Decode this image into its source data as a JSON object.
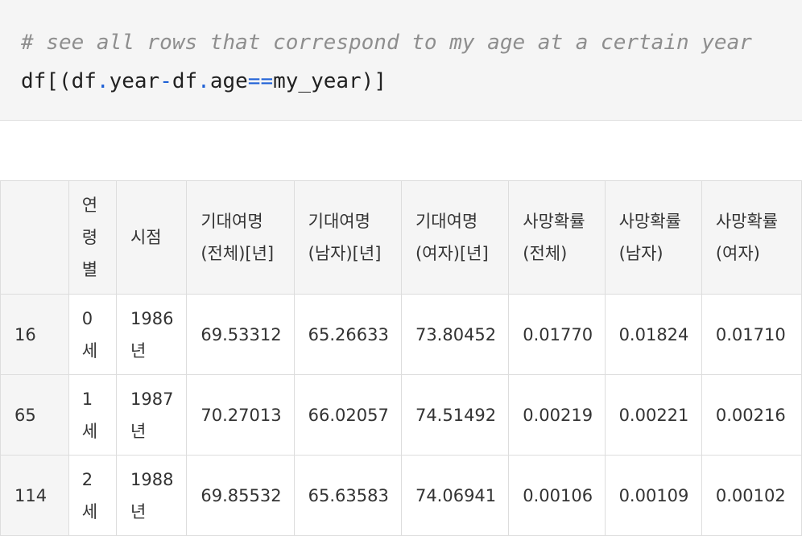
{
  "code_cell": {
    "comment": "# see all rows that correspond to my age at a certain year",
    "code_tokens": [
      "df[(df",
      ".",
      "year",
      "-",
      "df",
      ".",
      "age",
      "==",
      "my_year)]"
    ]
  },
  "table": {
    "columns": [
      "",
      "연령별",
      "시점",
      "기대여명(전체)[년]",
      "기대여명(남자)[년]",
      "기대여명(여자)[년]",
      "사망확률(전체)",
      "사망확률(남자)",
      "사망확률(여자)"
    ],
    "rows": [
      [
        "16",
        "0세",
        "1986년",
        "69.53312",
        "65.26633",
        "73.80452",
        "0.01770",
        "0.01824",
        "0.01710"
      ],
      [
        "65",
        "1세",
        "1987년",
        "70.27013",
        "66.02057",
        "74.51492",
        "0.00219",
        "0.00221",
        "0.00216"
      ],
      [
        "114",
        "2세",
        "1988년",
        "69.85532",
        "65.63583",
        "74.06941",
        "0.00106",
        "0.00109",
        "0.00102"
      ]
    ]
  },
  "colors": {
    "code_background": "#f5f5f5",
    "comment": "#8e8e8e",
    "operator": "#1d5fd6",
    "header_background": "#f5f5f5",
    "border": "#dddddd"
  }
}
